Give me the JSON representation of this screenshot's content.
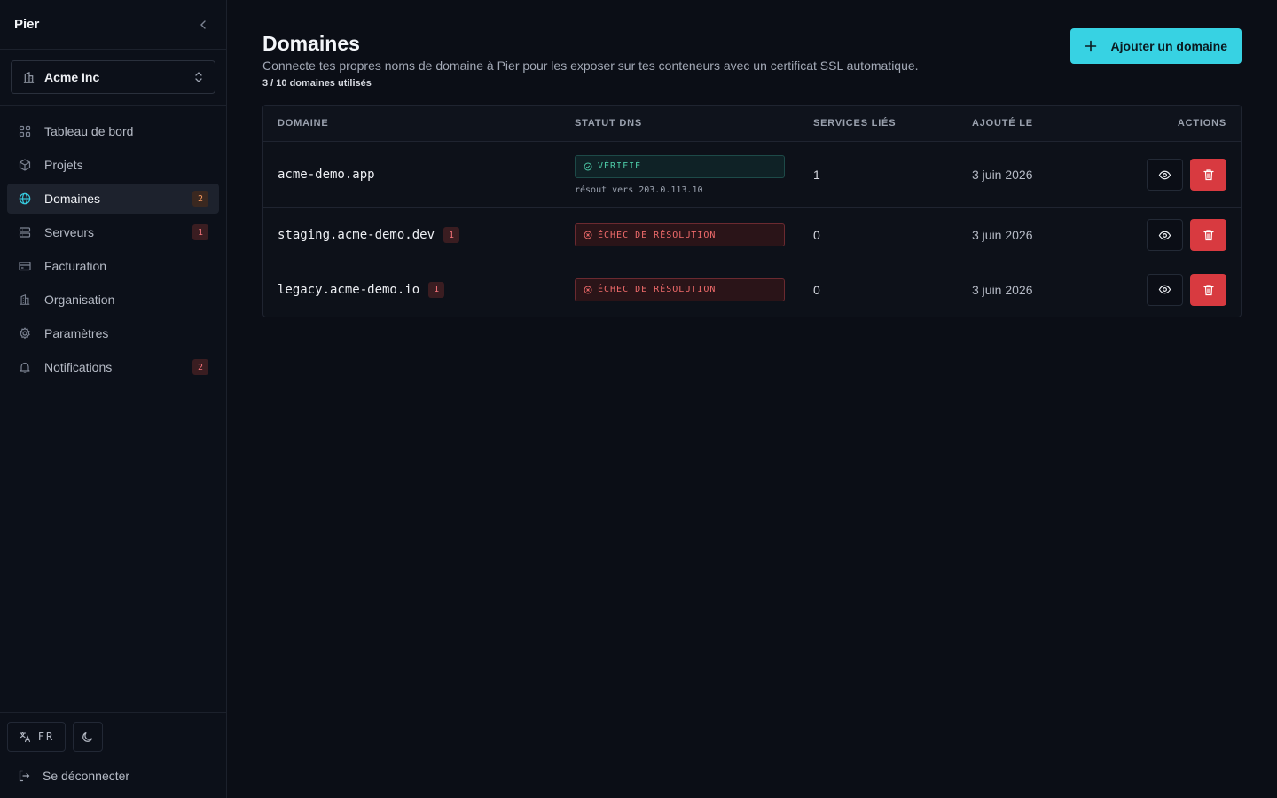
{
  "app": {
    "brand": "Pier"
  },
  "org": {
    "name": "Acme Inc"
  },
  "nav": [
    {
      "label": "Tableau de bord",
      "icon": "grid-icon",
      "badge": null
    },
    {
      "label": "Projets",
      "icon": "box-icon",
      "badge": null
    },
    {
      "label": "Domaines",
      "icon": "globe-icon",
      "badge": "2",
      "active": true
    },
    {
      "label": "Serveurs",
      "icon": "server-icon",
      "badge": "1"
    },
    {
      "label": "Facturation",
      "icon": "credit-card-icon",
      "badge": null
    },
    {
      "label": "Organisation",
      "icon": "building-icon",
      "badge": null
    },
    {
      "label": "Paramètres",
      "icon": "gear-icon",
      "badge": null
    },
    {
      "label": "Notifications",
      "icon": "bell-icon",
      "badge": "2"
    }
  ],
  "footer": {
    "lang": "FR",
    "logout": "Se déconnecter"
  },
  "page": {
    "title": "Domaines",
    "description": "Connecte tes propres noms de domaine à Pier pour les exposer sur tes conteneurs avec un certificat SSL automatique.",
    "usage": "3 / 10 domaines utilisés",
    "add_button": "Ajouter un domaine"
  },
  "table": {
    "headers": [
      "DOMAINE",
      "STATUT DNS",
      "SERVICES LIÉS",
      "AJOUTÉ LE",
      "ACTIONS"
    ],
    "rows": [
      {
        "domain": "acme-demo.app",
        "badge": null,
        "status": "VÉRIFIÉ",
        "status_kind": "ok",
        "resolves": "résout vers 203.0.113.10",
        "services": "1",
        "added": "3 juin 2026"
      },
      {
        "domain": "staging.acme-demo.dev",
        "badge": "1",
        "status": "ÉCHEC DE RÉSOLUTION",
        "status_kind": "err",
        "resolves": null,
        "services": "0",
        "added": "3 juin 2026"
      },
      {
        "domain": "legacy.acme-demo.io",
        "badge": "1",
        "status": "ÉCHEC DE RÉSOLUTION",
        "status_kind": "err",
        "resolves": null,
        "services": "0",
        "added": "3 juin 2026"
      }
    ]
  },
  "colors": {
    "accent": "#37d2e3",
    "danger": "#d83a40",
    "success": "#4cc9a6"
  }
}
